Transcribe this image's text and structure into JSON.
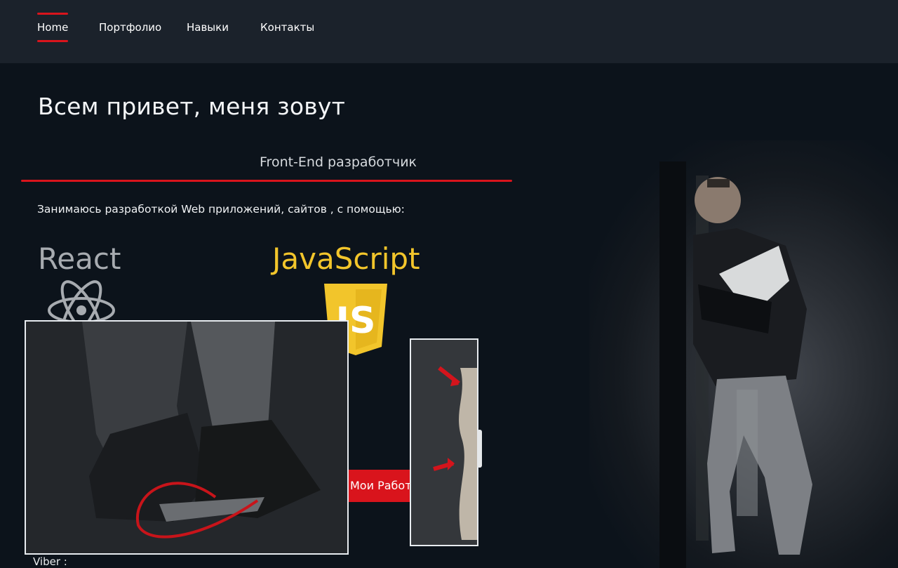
{
  "nav": {
    "items": [
      {
        "label": "Home",
        "active": true
      },
      {
        "label": "Портфолио",
        "active": false
      },
      {
        "label": "Навыки",
        "active": false
      },
      {
        "label": "Контакты",
        "active": false
      }
    ]
  },
  "hero": {
    "title": "Всем привет, меня зовут",
    "role": "Front-End разработчик",
    "description": "Занимаюсь разработкой Web приложений, сайтов , с помощью:"
  },
  "tech": {
    "react_label": "React",
    "js_label": "JavaScript",
    "js_icon_text": "JS"
  },
  "cta": {
    "works_label": "Мои Работы"
  },
  "contacts": {
    "viber_label": "Viber :"
  },
  "colors": {
    "accent_red": "#d9141c",
    "nav_bg": "#1b222b",
    "page_bg": "#0c131b",
    "js_yellow": "#f2c52b"
  }
}
